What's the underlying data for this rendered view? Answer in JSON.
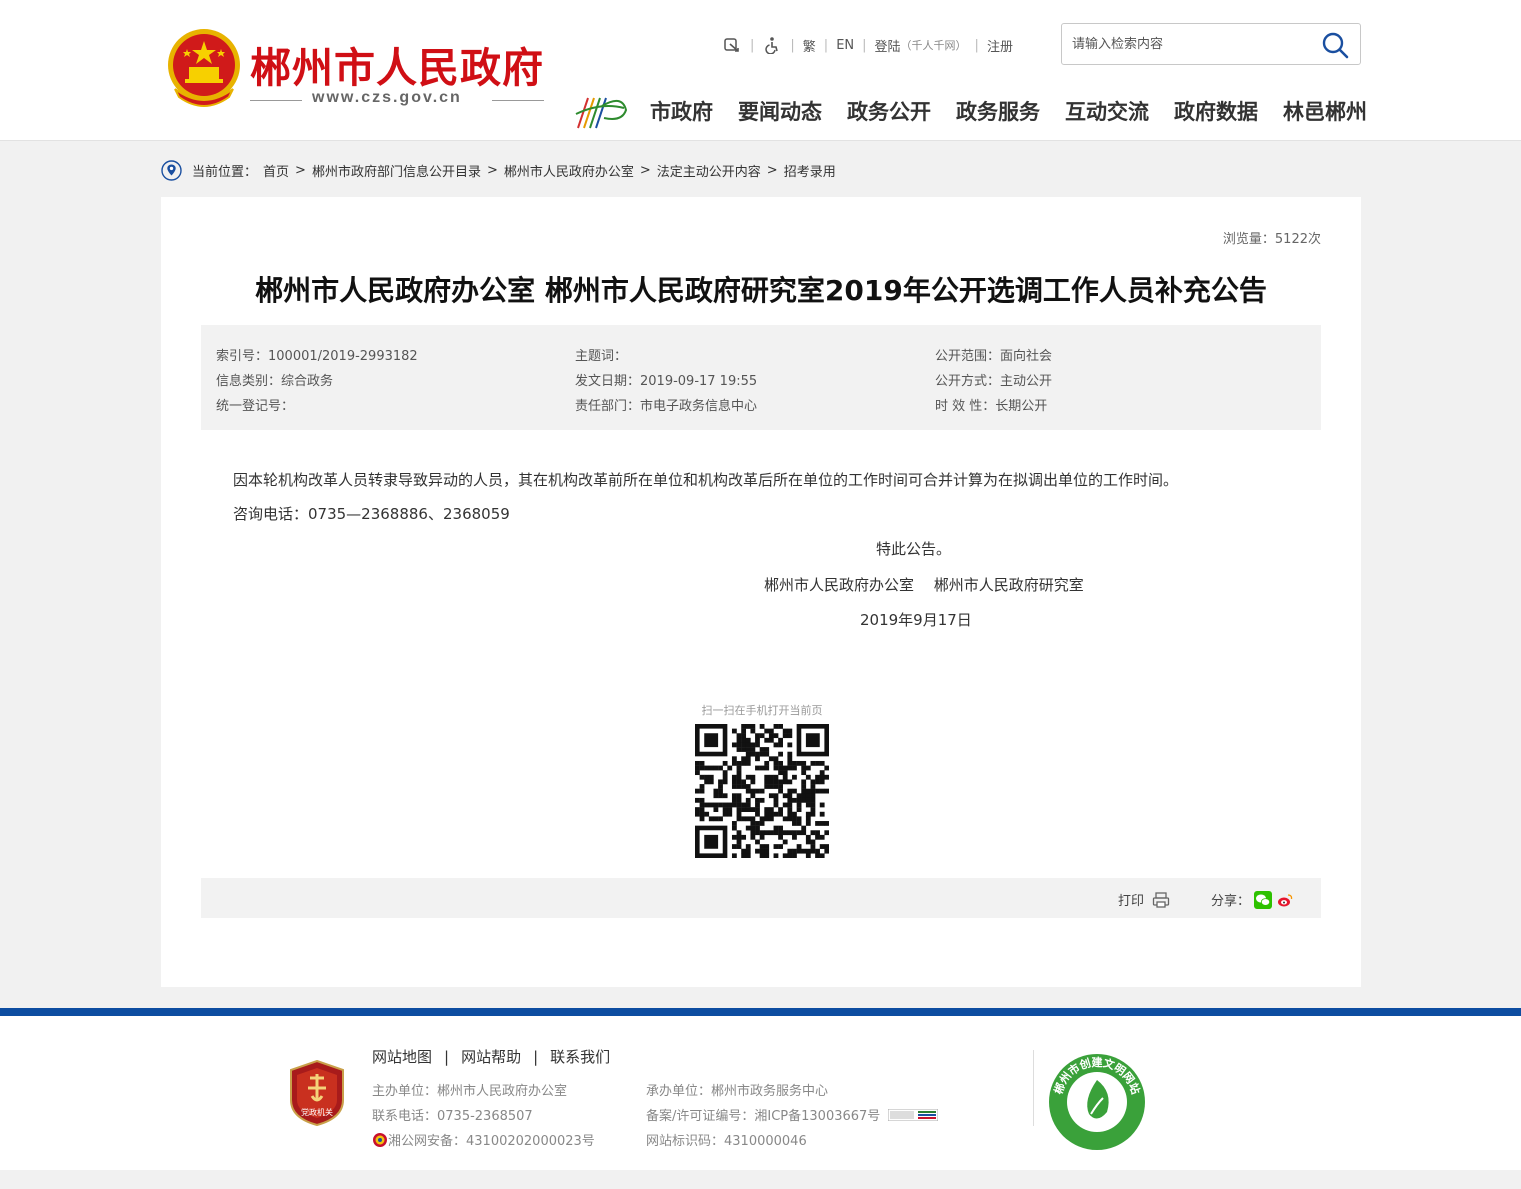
{
  "header": {
    "site_name": "郴州市人民政府",
    "site_url": "www.czs.gov.cn",
    "tools": {
      "traditional": "繁",
      "english": "EN",
      "login": "登陆",
      "login_note": "（千人千网）",
      "register": "注册"
    },
    "search": {
      "placeholder": "请输入检索内容"
    },
    "nav": [
      "市政府",
      "要闻动态",
      "政务公开",
      "政务服务",
      "互动交流",
      "政府数据",
      "林邑郴州"
    ]
  },
  "breadcrumb": {
    "label": "当前位置：",
    "items": [
      "首页",
      "郴州市政府部门信息公开目录",
      "郴州市人民政府办公室",
      "法定主动公开内容",
      "招考录用"
    ]
  },
  "article": {
    "views": "浏览量：5122次",
    "title": "郴州市人民政府办公室 郴州市人民政府研究室2019年公开选调工作人员补充公告",
    "meta": {
      "index_no": "索引号：100001/2019-2993182",
      "subject": "主题词：",
      "scope": "公开范围：面向社会",
      "category": "信息类别：综合政务",
      "publish_date": "发文日期：2019-09-17 19:55",
      "method": "公开方式：主动公开",
      "reg_no": "统一登记号：",
      "department": "责任部门：市电子政务信息中心",
      "validity": "时 效 性：长期公开"
    },
    "body": [
      "因本轮机构改革人员转隶导致异动的人员，其在机构改革前所在单位和机构改革后所在单位的工作时间可合并计算为在拟调出单位的工作时间。",
      "咨询电话：0735—2368886、2368059"
    ],
    "closing": "特此公告。",
    "signature": "郴州市人民政府办公室　 郴州市人民政府研究室",
    "date": "2019年9月17日",
    "qr_caption": "扫一扫在手机打开当前页",
    "print_label": "打印",
    "share_label": "分享："
  },
  "footer": {
    "links": [
      "网站地图",
      "网站帮助",
      "联系我们"
    ],
    "host": "主办单位：郴州市人民政府办公室",
    "phone": "联系电话：0735-2368507",
    "police": "湘公网安备：43100202000023号",
    "organizer": "承办单位：郴州市政务服务中心",
    "icp": "备案/许可证编号：湘ICP备13003667号",
    "site_code": "网站标识码：4310000046",
    "badge_text": "党政机关",
    "civ_text": "郴州市创建文明网站"
  },
  "colors": {
    "brand_red": "#d00f15",
    "footer_blue": "#0d4da1",
    "civ_green": "#3aa13a"
  },
  "icons": [
    "emblem-icon",
    "accessibility-icon",
    "wheelchair-icon",
    "search-icon",
    "location-pin-icon",
    "print-icon",
    "wechat-icon",
    "weibo-icon",
    "party-badge-icon",
    "civilization-badge-icon"
  ]
}
